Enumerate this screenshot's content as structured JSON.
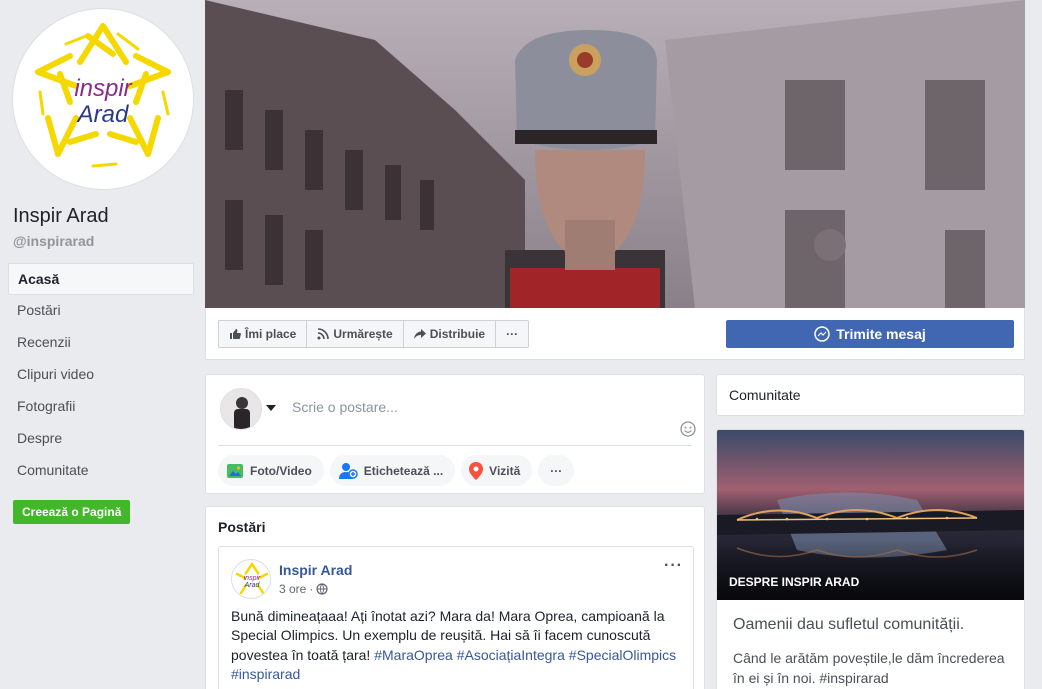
{
  "page": {
    "name": "Inspir Arad",
    "handle": "@inspirarad",
    "logo_text_top": "inspir",
    "logo_text_bottom": "Arad"
  },
  "nav": {
    "items": [
      {
        "label": "Acasă",
        "active": true
      },
      {
        "label": "Postări"
      },
      {
        "label": "Recenzii"
      },
      {
        "label": "Clipuri video"
      },
      {
        "label": "Fotografii"
      },
      {
        "label": "Despre"
      },
      {
        "label": "Comunitate"
      }
    ],
    "create_page_label": "Creează o Pagină"
  },
  "actions": {
    "like_label": "Îmi place",
    "follow_label": "Urmărește",
    "share_label": "Distribuie",
    "more_label": "···",
    "message_label": "Trimite mesaj"
  },
  "composer": {
    "placeholder": "Scrie o postare...",
    "photo_video_label": "Foto/Video",
    "tag_label": "Etichetează ...",
    "checkin_label": "Vizită",
    "more_label": "···"
  },
  "posts": {
    "section_title": "Postări",
    "first": {
      "author": "Inspir Arad",
      "time": "3 ore",
      "separator": "·",
      "menu": "···",
      "text": "Bună dimineațaaa! Ați înotat azi? Mara da! Mara Oprea, campioană la Special Olimpics. Un exemplu de reușită. Hai să îi facem cunoscută povestea în toată țara!",
      "hashtags": [
        "#MaraOprea",
        "#AsociațiaIntegra",
        "#SpecialOlimpics",
        "#inspirarad"
      ]
    }
  },
  "sidebar_right": {
    "community_title": "Comunitate",
    "about_label": "DESPRE INSPIR ARAD",
    "about_headline": "Oamenii dau sufletul comunității.",
    "about_text": "Când le arătăm poveștile,le dăm încrederea în ei și în noi. #inspirarad"
  },
  "colors": {
    "background": "#e9ebee",
    "facebook_blue": "#4267b2",
    "link_blue": "#365899",
    "green": "#42b72a",
    "logo_yellow": "#f5d800",
    "logo_purple": "#8a2a8a",
    "logo_navy": "#2a3a8a"
  }
}
